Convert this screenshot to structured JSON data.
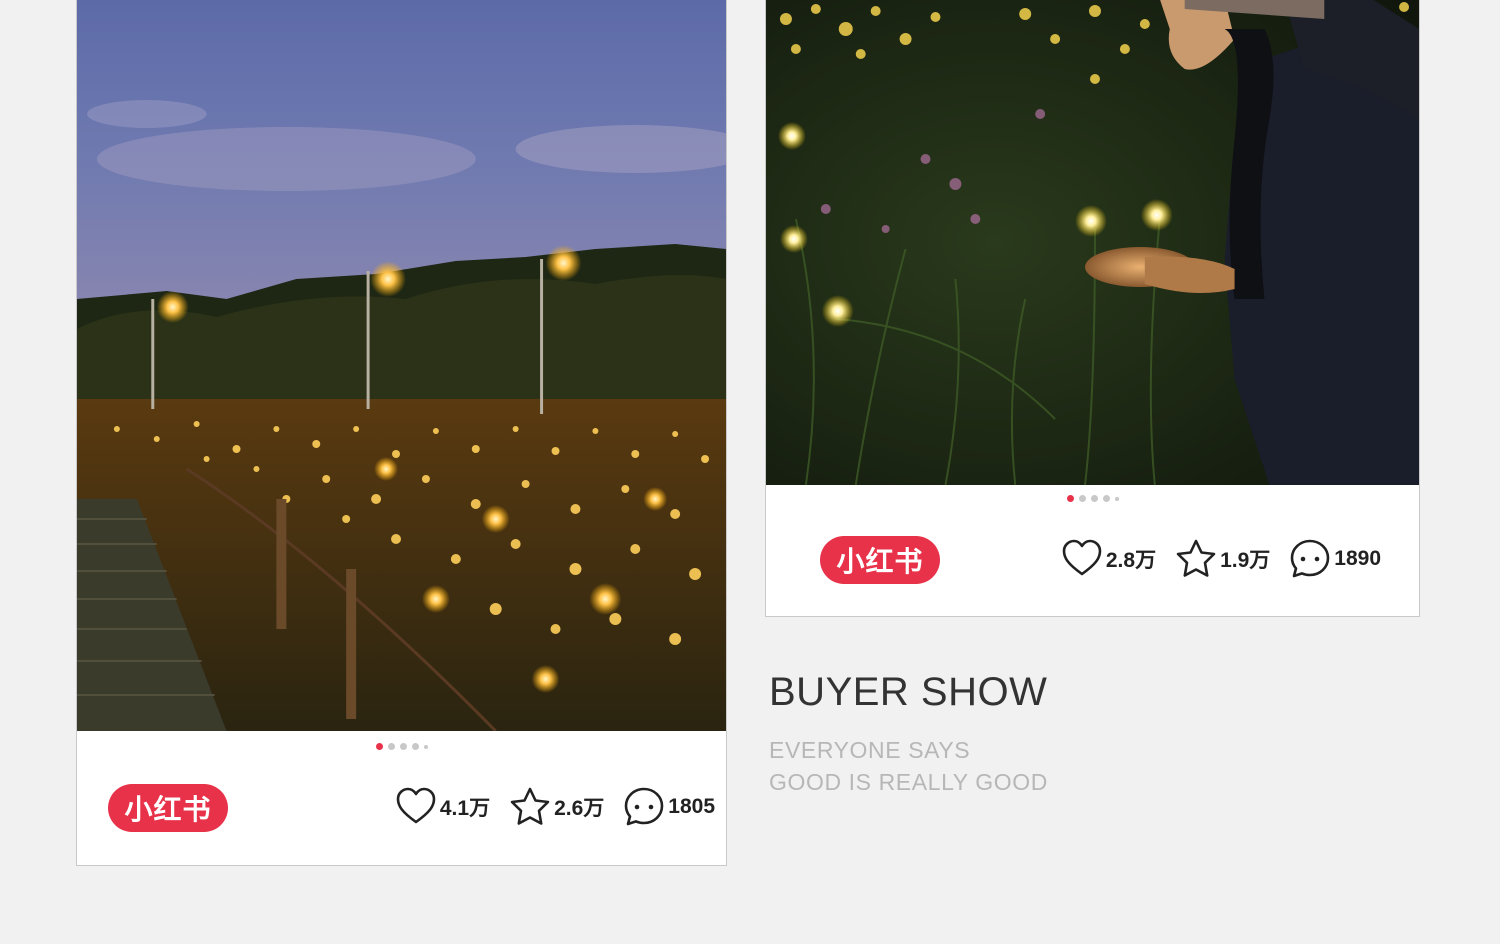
{
  "brand": {
    "label": "小红书",
    "color": "#e8324a"
  },
  "posts": [
    {
      "image": "night-field-of-firefly-lights-with-street-lamps",
      "carousel": {
        "count": 5,
        "active": 0
      },
      "likes": "4.1万",
      "favorites": "2.6万",
      "comments": "1805"
    },
    {
      "image": "woman-holding-firefly-lights-in-garden",
      "carousel": {
        "count": 5,
        "active": 0
      },
      "likes": "2.8万",
      "favorites": "1.9万",
      "comments": "1890"
    }
  ],
  "caption": {
    "title": "BUYER SHOW",
    "line1": "EVERYONE SAYS",
    "line2": "GOOD IS REALLY GOOD"
  },
  "icons": {
    "like": "heart-icon",
    "favorite": "star-icon",
    "comment": "speech-bubble-icon"
  }
}
